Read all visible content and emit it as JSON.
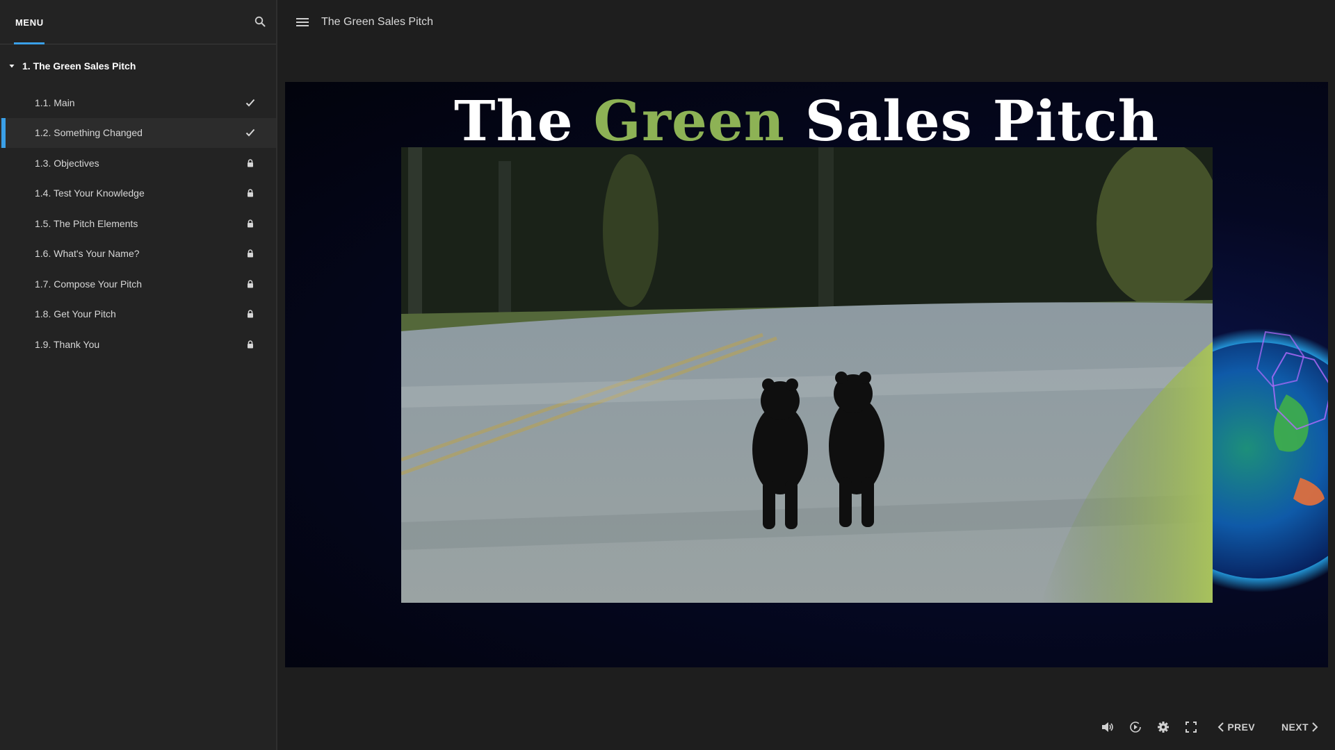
{
  "sidebar": {
    "menu_label": "MENU",
    "section_title": "1. The Green Sales Pitch",
    "lessons": [
      {
        "label": "1.1. Main",
        "state": "complete"
      },
      {
        "label": "1.2. Something Changed",
        "state": "complete"
      },
      {
        "label": "1.3. Objectives",
        "state": "locked"
      },
      {
        "label": "1.4. Test Your Knowledge",
        "state": "locked"
      },
      {
        "label": "1.5. The Pitch Elements",
        "state": "locked"
      },
      {
        "label": "1.6. What's Your Name?",
        "state": "locked"
      },
      {
        "label": "1.7. Compose Your Pitch",
        "state": "locked"
      },
      {
        "label": "1.8. Get Your Pitch",
        "state": "locked"
      },
      {
        "label": "1.9. Thank You",
        "state": "locked"
      }
    ],
    "active_index": 1
  },
  "topbar": {
    "course_title": "The Green Sales Pitch"
  },
  "slide": {
    "title_part1": "The ",
    "title_accent": "Green",
    "title_part2": " Sales Pitch",
    "accent_color": "#8db255"
  },
  "controls": {
    "prev_label": "PREV",
    "next_label": "NEXT"
  },
  "colors": {
    "highlight": "#3aa0e8",
    "background": "#1e1e1e",
    "sidebar": "#232323"
  }
}
